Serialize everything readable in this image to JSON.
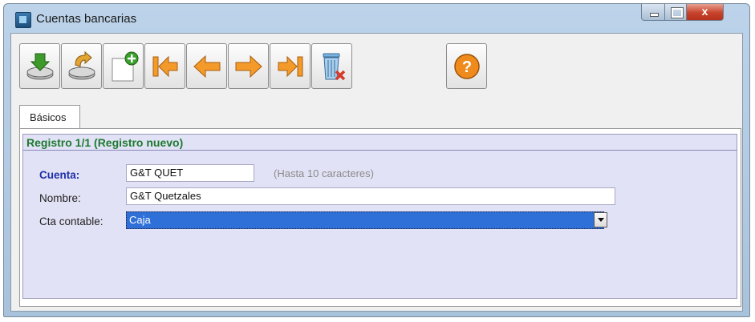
{
  "window": {
    "title": "Cuentas bancarias",
    "close_glyph": "x"
  },
  "toolbar": {
    "buttons": [
      {
        "name": "save-record-button",
        "icon": "disk-down-arrow-icon"
      },
      {
        "name": "undo-changes-button",
        "icon": "disk-undo-icon"
      },
      {
        "name": "new-record-button",
        "icon": "new-document-plus-icon"
      },
      {
        "name": "first-record-button",
        "icon": "first-arrow-icon"
      },
      {
        "name": "previous-record-button",
        "icon": "left-arrow-icon"
      },
      {
        "name": "next-record-button",
        "icon": "right-arrow-icon"
      },
      {
        "name": "last-record-button",
        "icon": "last-arrow-icon"
      },
      {
        "name": "delete-record-button",
        "icon": "recycle-bin-delete-icon"
      },
      {
        "name": "help-button",
        "icon": "help-question-icon"
      }
    ]
  },
  "tabs": {
    "active_label": "Básicos"
  },
  "form": {
    "record_status": "Registro 1/1 (Registro nuevo)",
    "cuenta_label": "Cuenta:",
    "cuenta_value": "G&T QUET",
    "cuenta_hint": "(Hasta 10 caracteres)",
    "nombre_label": "Nombre:",
    "nombre_value": "G&T Quetzales",
    "cta_label": "Cta contable:",
    "cta_value": "Caja"
  },
  "colors": {
    "arrow_orange": "#f39a2b",
    "record_status_green": "#1e7a30",
    "required_label_blue": "#1f2fa8",
    "form_background": "#e2e2f6",
    "selection_blue": "#2f6fd8"
  }
}
